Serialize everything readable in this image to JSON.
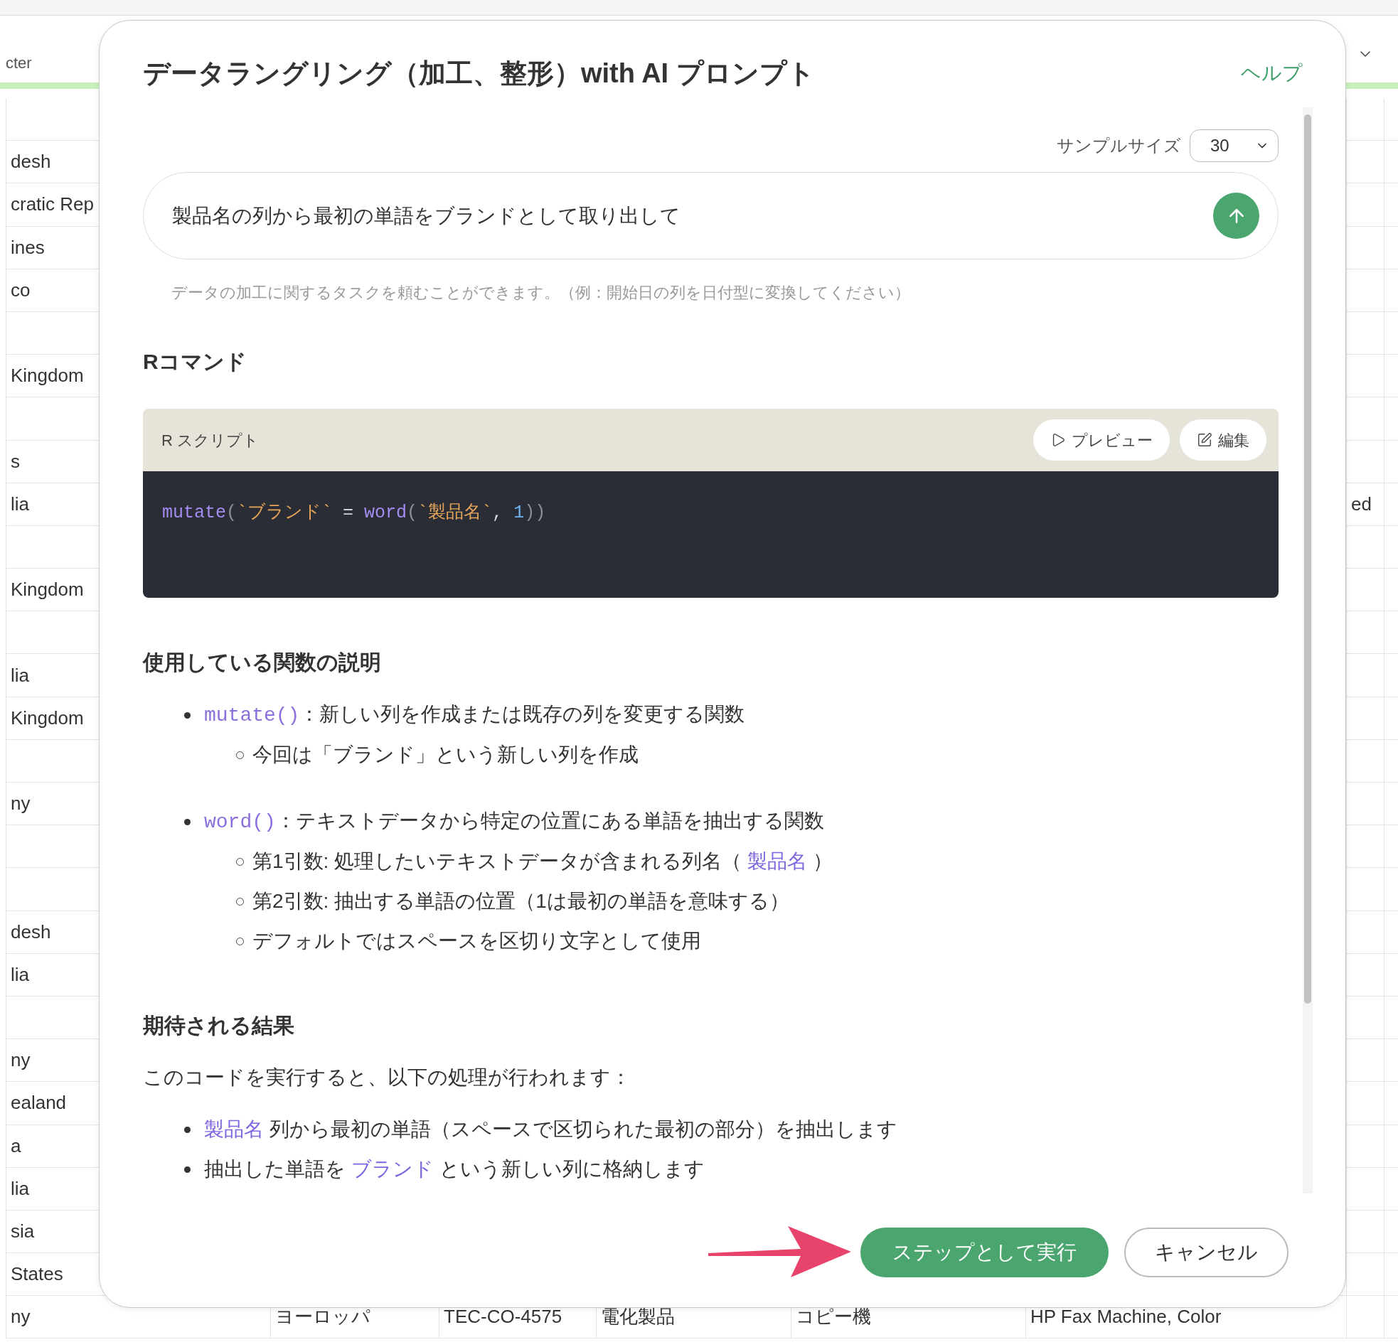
{
  "sheet": {
    "header_cell": "cter",
    "rows": [
      {},
      {
        "column_1": "desh"
      },
      {
        "column_1": "cratic Rep"
      },
      {
        "column_1": "ines"
      },
      {
        "column_1": "co"
      },
      {},
      {
        "column_1": "Kingdom"
      },
      {},
      {
        "column_1": "s"
      },
      {
        "column_1": "lia",
        "column_7": "ed"
      },
      {},
      {
        "column_1": "Kingdom"
      },
      {},
      {
        "column_1": "lia"
      },
      {
        "column_1": "Kingdom"
      },
      {},
      {
        "column_1": "ny"
      },
      {},
      {},
      {
        "column_1": "desh"
      },
      {
        "column_1": "lia"
      },
      {},
      {
        "column_1": "ny"
      },
      {
        "column_1": "ealand"
      },
      {
        "column_1": "a"
      },
      {
        "column_1": "lia"
      },
      {
        "column_1": "sia"
      },
      {
        "column_1": "States"
      },
      {
        "column_1": "ny",
        "column_2": "ヨーロッパ",
        "column_3": "TEC-CO-4575",
        "column_4": "電化製品",
        "column_5": "コピー機",
        "column_6": "HP Fax Machine, Color"
      }
    ]
  },
  "dialog": {
    "title": "データラングリング（加工、整形）with AI プロンプト",
    "help_link": "ヘルプ",
    "sample_size": {
      "label": "サンプルサイズ",
      "value": "30"
    },
    "prompt": {
      "value": "製品名の列から最初の単語をブランドとして取り出して",
      "helper_text": "データの加工に関するタスクを頼むことができます。（例：開始日の列を日付型に変換してください）"
    },
    "command_heading": "Rコマンド",
    "script": {
      "title": "R スクリプト",
      "buttons": [
        {
          "kind": "preview",
          "label": "プレビュー"
        },
        {
          "kind": "edit",
          "label": "編集"
        }
      ],
      "tokens": [
        {
          "kind": "func",
          "text": "mutate"
        },
        {
          "kind": "punct",
          "text": "("
        },
        {
          "kind": "string",
          "text": "`ブランド`"
        },
        {
          "kind": "op",
          "text": " = "
        },
        {
          "kind": "func",
          "text": "word"
        },
        {
          "kind": "punct",
          "text": "("
        },
        {
          "kind": "string",
          "text": "`製品名`"
        },
        {
          "kind": "op",
          "text": ", "
        },
        {
          "kind": "number",
          "text": "1"
        },
        {
          "kind": "punct",
          "text": "))"
        }
      ]
    },
    "sections": [
      {
        "heading": "使用している関数の説明",
        "blocks": [
          {
            "kind": "list",
            "items": [
              {
                "parts": [
                  {
                    "kind": "code",
                    "text": "mutate()"
                  },
                  {
                    "kind": "plain",
                    "text": "：新しい列を作成または既存の列を変更する関数"
                  }
                ],
                "children": [
                  {
                    "parts": [
                      {
                        "kind": "plain",
                        "text": "今回は「ブランド」という新しい列を作成"
                      }
                    ]
                  }
                ]
              },
              {
                "parts": [
                  {
                    "kind": "code",
                    "text": "word()"
                  },
                  {
                    "kind": "plain",
                    "text": "：テキストデータから特定の位置にある単語を抽出する関数"
                  }
                ],
                "children": [
                  {
                    "parts": [
                      {
                        "kind": "plain",
                        "text": "第1引数: 処理したいテキストデータが含まれる列名（ "
                      },
                      {
                        "kind": "ref",
                        "text": "製品名"
                      },
                      {
                        "kind": "plain",
                        "text": " ）"
                      }
                    ]
                  },
                  {
                    "parts": [
                      {
                        "kind": "plain",
                        "text": "第2引数: 抽出する単語の位置（1は最初の単語を意味する）"
                      }
                    ]
                  },
                  {
                    "parts": [
                      {
                        "kind": "plain",
                        "text": "デフォルトではスペースを区切り文字として使用"
                      }
                    ]
                  }
                ]
              }
            ]
          }
        ]
      },
      {
        "heading": "期待される結果",
        "blocks": [
          {
            "kind": "paragraph",
            "text": "このコードを実行すると、以下の処理が行われます："
          },
          {
            "kind": "list",
            "items": [
              {
                "parts": [
                  {
                    "kind": "ref",
                    "text": "製品名"
                  },
                  {
                    "kind": "plain",
                    "text": " 列から最初の単語（スペースで区切られた最初の部分）を抽出します"
                  }
                ]
              },
              {
                "parts": [
                  {
                    "kind": "plain",
                    "text": "抽出した単語を "
                  },
                  {
                    "kind": "ref",
                    "text": "ブランド"
                  },
                  {
                    "kind": "plain",
                    "text": " という新しい列に格納します"
                  }
                ]
              }
            ]
          }
        ]
      }
    ],
    "buttons": [
      {
        "kind": "primary",
        "label": "ステップとして実行"
      },
      {
        "kind": "secondary",
        "label": "キャンセル"
      }
    ]
  }
}
